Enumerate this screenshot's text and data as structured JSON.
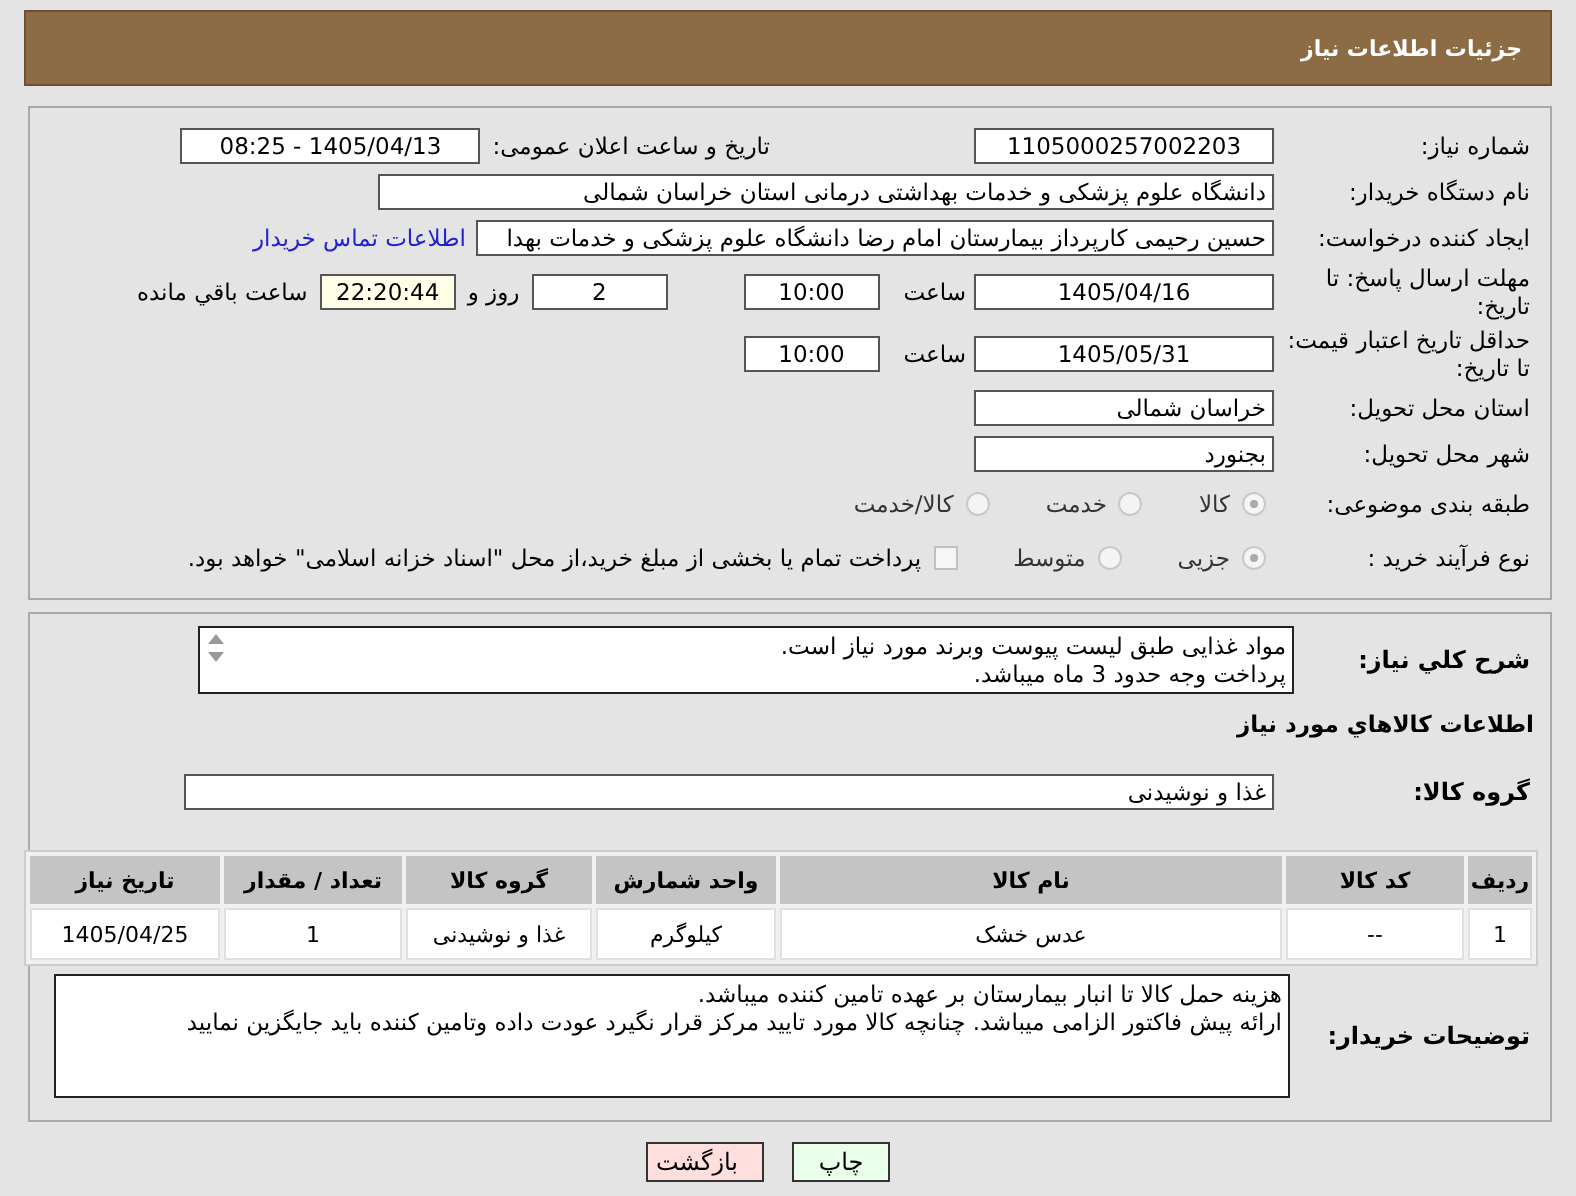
{
  "header": {
    "title": "جزئیات اطلاعات نیاز"
  },
  "need_number": {
    "label": "شماره نیاز:",
    "value": "1105000257002203"
  },
  "announce": {
    "label": "تاریخ و ساعت اعلان عمومی:",
    "value": "1405/04/13 - 08:25"
  },
  "buyer_org": {
    "label": "نام دستگاه خریدار:",
    "value": "دانشگاه علوم پزشکی و خدمات بهداشتی درمانی استان خراسان شمالی"
  },
  "requester": {
    "label": "ایجاد کننده درخواست:",
    "value": "حسین رحیمی کارپرداز بیمارستان امام رضا دانشگاه علوم پزشکی و خدمات بهدا",
    "link": "اطلاعات تماس خریدار"
  },
  "response_deadline": {
    "label": "مهلت ارسال پاسخ: تا تاریخ:",
    "date": "1405/04/16",
    "time_label": "ساعت",
    "time": "10:00",
    "days": "2",
    "days_label": "روز و",
    "remaining": "22:20:44",
    "remaining_label": "ساعت باقي مانده"
  },
  "price_validity": {
    "label": "حداقل تاریخ اعتبار قیمت: تا تاریخ:",
    "date": "1405/05/31",
    "time_label": "ساعت",
    "time": "10:00"
  },
  "delivery_province": {
    "label": "استان محل تحویل:",
    "value": "خراسان شمالی"
  },
  "delivery_city": {
    "label": "شهر محل تحویل:",
    "value": "بجنورد"
  },
  "category": {
    "label": "طبقه بندی موضوعی:",
    "options": [
      {
        "label": "کالا",
        "selected": true
      },
      {
        "label": "خدمت",
        "selected": false
      },
      {
        "label": "کالا/خدمت",
        "selected": false
      }
    ]
  },
  "process": {
    "label": "نوع فرآیند خرید :",
    "options": [
      {
        "label": "جزیی",
        "selected": true
      },
      {
        "label": "متوسط",
        "selected": false
      }
    ],
    "treasury": {
      "label": "پرداخت تمام یا بخشی از مبلغ خرید،از محل \"اسناد خزانه اسلامی\" خواهد بود.",
      "checked": false
    }
  },
  "description": {
    "label": "شرح کلي نیاز:",
    "lines": [
      "مواد غذایی طبق لیست پیوست وبرند مورد نیاز است.",
      "پرداخت وجه حدود 3 ماه میباشد."
    ]
  },
  "goods_section": {
    "title": "اطلاعات کالاهاي مورد نیاز"
  },
  "goods_group": {
    "label": "گروه کالا:",
    "value": "غذا و نوشیدنی"
  },
  "table": {
    "columns": [
      "ردیف",
      "کد کالا",
      "نام کالا",
      "واحد شمارش",
      "گروه کالا",
      "تعداد / مقدار",
      "تاریخ نیاز"
    ],
    "rows": [
      [
        "1",
        "--",
        "عدس خشک",
        "کیلوگرم",
        "غذا و نوشیدنی",
        "1",
        "1405/04/25"
      ]
    ]
  },
  "buyer_notes": {
    "label": "توضیحات خریدار:",
    "lines": [
      "هزینه حمل کالا تا انبار بیمارستان بر عهده تامین کننده میباشد.",
      "ارائه پیش فاکتور الزامی میباشد. چنانچه کالا مورد تایید مرکز قرار نگیرد عودت داده وتامین کننده باید جایگزین نمایید"
    ]
  },
  "buttons": [
    {
      "label": "چاپ",
      "kind": "print"
    },
    {
      "label": "بازگشت",
      "kind": "back"
    }
  ]
}
